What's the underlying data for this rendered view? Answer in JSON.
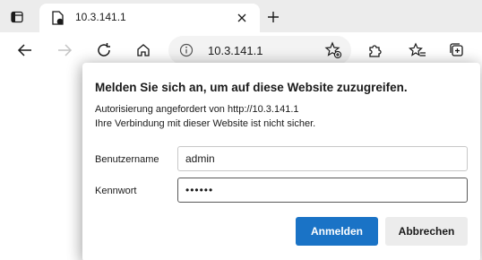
{
  "tab": {
    "title": "10.3.141.1"
  },
  "address": {
    "url": "10.3.141.1"
  },
  "dialog": {
    "title": "Melden Sie sich an, um auf diese Website zuzugreifen.",
    "line1": "Autorisierung angefordert von http://10.3.141.1",
    "line2": "Ihre Verbindung mit dieser Website ist nicht sicher.",
    "username_label": "Benutzername",
    "username_value": "admin",
    "password_label": "Kennwort",
    "password_value": "••••••",
    "login_button": "Anmelden",
    "cancel_button": "Abbrechen"
  },
  "icons": {
    "tab_actions": "tab-actions-icon",
    "favicon": "document-icon",
    "tab_close": "close-icon",
    "new_tab": "plus-icon",
    "back": "arrow-left-icon",
    "forward": "arrow-right-icon",
    "refresh": "refresh-icon",
    "home": "home-icon",
    "info": "info-icon",
    "add_favorite": "star-plus-icon",
    "extensions": "puzzle-icon",
    "favorites": "star-list-icon",
    "collections": "collections-icon"
  },
  "colors": {
    "primary": "#1a73c6",
    "tabbar_bg": "#ececec",
    "address_bg": "#f3f3f3"
  }
}
